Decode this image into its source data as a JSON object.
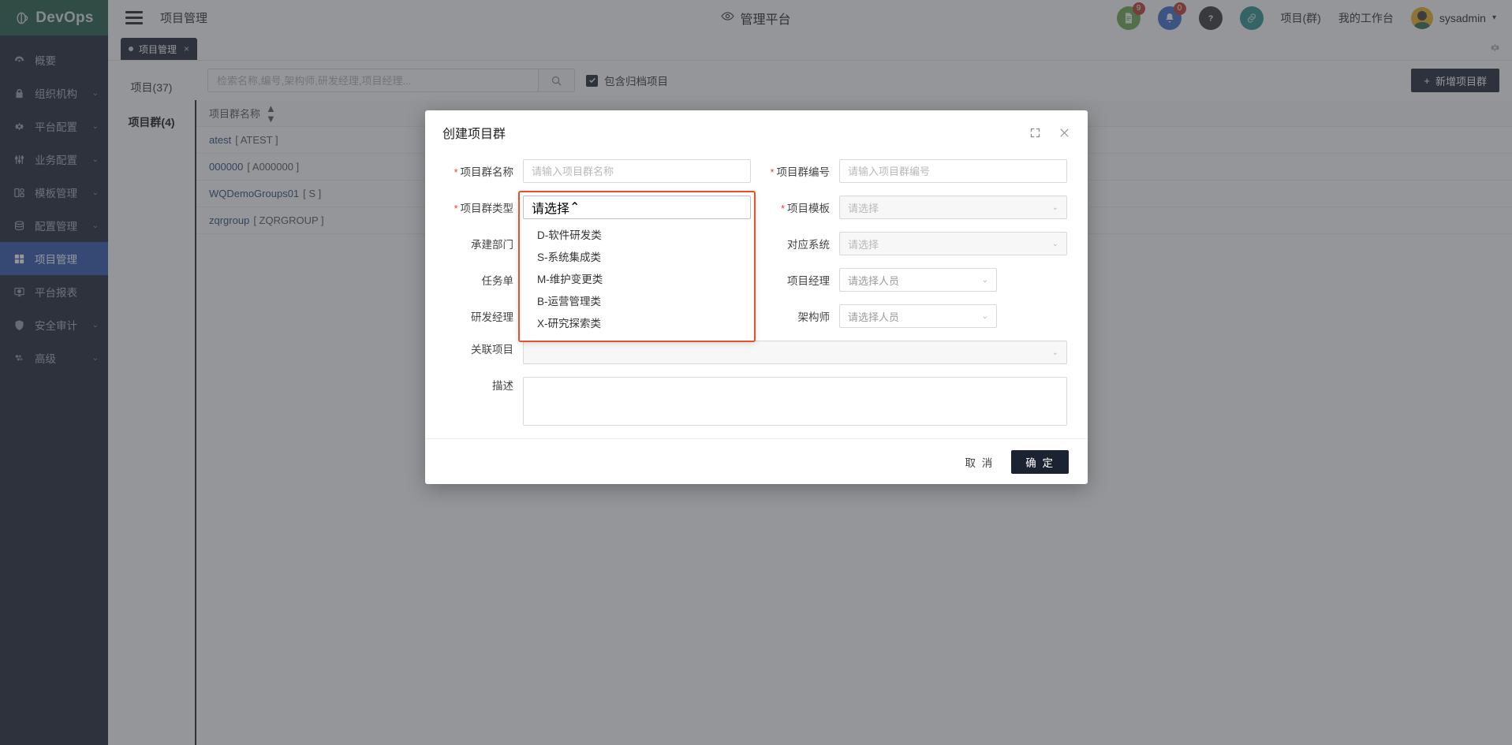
{
  "header": {
    "logo_text": "DevOps",
    "logo_icon": "devops-logo-icon",
    "breadcrumb": "项目管理",
    "center_title": "管理平台",
    "center_icon": "eye-icon",
    "menu_icon": "hamburger-icon",
    "icons": [
      {
        "name": "document-icon",
        "badge": "9",
        "color": "#6aa84f"
      },
      {
        "name": "bell-icon",
        "badge": "0",
        "color": "#3c6ed0"
      },
      {
        "name": "help-icon",
        "badge": "",
        "color": "#333333"
      },
      {
        "name": "link-icon",
        "badge": "",
        "color": "#2e9190"
      }
    ],
    "links": [
      "项目(群)",
      "我的工作台"
    ],
    "user": "sysadmin",
    "user_caret": "▾"
  },
  "sidebar": {
    "items": [
      {
        "label": "概要",
        "icon": "dashboard-icon",
        "chevron": false,
        "active": false
      },
      {
        "label": "组织机构",
        "icon": "lock-icon",
        "chevron": true,
        "active": false
      },
      {
        "label": "平台配置",
        "icon": "gear-icon",
        "chevron": true,
        "active": false
      },
      {
        "label": "业务配置",
        "icon": "sliders-icon",
        "chevron": true,
        "active": false
      },
      {
        "label": "模板管理",
        "icon": "template-icon",
        "chevron": true,
        "active": false
      },
      {
        "label": "配置管理",
        "icon": "database-icon",
        "chevron": true,
        "active": false
      },
      {
        "label": "项目管理",
        "icon": "grid-icon",
        "chevron": false,
        "active": true
      },
      {
        "label": "平台报表",
        "icon": "report-icon",
        "chevron": false,
        "active": false
      },
      {
        "label": "安全审计",
        "icon": "shield-icon",
        "chevron": true,
        "active": false
      },
      {
        "label": "高级",
        "icon": "advanced-icon",
        "chevron": true,
        "active": false
      }
    ]
  },
  "tabstrip": {
    "tab_label": "项目管理",
    "tab_close": "×",
    "gear_icon": "gear-icon"
  },
  "listnav": {
    "items": [
      {
        "label": "项目(37)",
        "active": false
      },
      {
        "label": "项目群(4)",
        "active": true
      }
    ]
  },
  "toolbar": {
    "search_placeholder": "检索名称,编号,架构师,研发经理,项目经理...",
    "search_value": "",
    "search_icon": "search-icon",
    "checkbox_label": "包含归档项目",
    "checkbox_checked": true,
    "add_button": "新增项目群",
    "add_icon": "plus-icon"
  },
  "table": {
    "column_header": "项目群名称",
    "sort_icon": "sort-icon",
    "rows": [
      {
        "name": "atest",
        "code": "[ ATEST ]"
      },
      {
        "name": "000000",
        "code": "[ A000000 ]"
      },
      {
        "name": "WQDemoGroups01",
        "code": "[ S ]"
      },
      {
        "name": "zqrgroup",
        "code": "[ ZQRGROUP ]"
      }
    ]
  },
  "modal": {
    "title": "创建项目群",
    "expand_icon": "expand-icon",
    "close_icon": "close-icon",
    "fields": {
      "name_label": "项目群名称",
      "name_placeholder": "请输入项目群名称",
      "name_value": "",
      "code_label": "项目群编号",
      "code_placeholder": "请输入项目群编号",
      "code_value": "",
      "type_label": "项目群类型",
      "type_placeholder": "请选择",
      "type_value": "",
      "template_label": "项目模板",
      "template_placeholder": "请选择",
      "dept_label": "承建部门",
      "system_label": "对应系统",
      "system_placeholder": "请选择",
      "task_label": "任务单",
      "pm_label": "项目经理",
      "pm_placeholder": "请选择人员",
      "devmgr_label": "研发经理",
      "architect_label": "架构师",
      "architect_placeholder": "请选择人员",
      "related_label": "关联项目",
      "desc_label": "描述",
      "desc_value": ""
    },
    "type_options": [
      "D-软件研发类",
      "S-系统集成类",
      "M-维护变更类",
      "B-运营管理类",
      "X-研究探索类"
    ],
    "cancel_label": "取 消",
    "confirm_label": "确 定"
  },
  "colors": {
    "brand_green": "#1f5c45",
    "sidebar_bg": "#1b2232",
    "active_blue": "#2f54b0",
    "focus_orange": "#e8502b",
    "required_red": "#e8413a",
    "link_blue": "#2c4a7c"
  }
}
